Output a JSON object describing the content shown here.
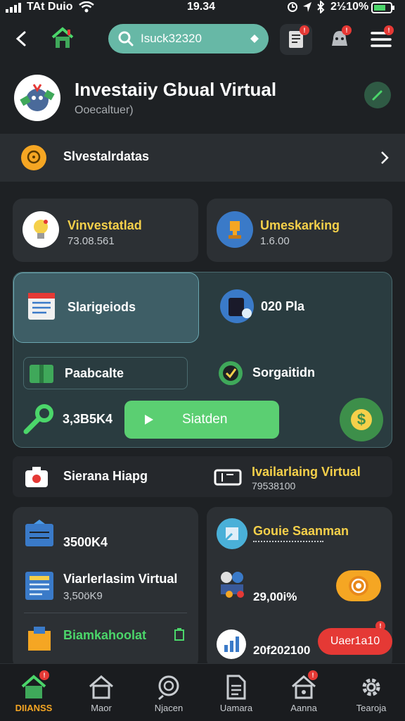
{
  "status": {
    "carrier": "TAt Duio",
    "time": "19.34",
    "battery": "2½10%"
  },
  "search": {
    "value": "Isuck32320"
  },
  "header": {
    "title": "Investaiiy Gbual Virtual",
    "subtitle": "Ooecaltuer)"
  },
  "banner": {
    "label": "Slvestalrdatas"
  },
  "cards": {
    "c1": {
      "title": "Vinvestatlad",
      "value": "73.08.561"
    },
    "c2": {
      "title": "Umeskarking",
      "value": "1.6.00"
    }
  },
  "panel": {
    "item1": "Slarigeiods",
    "item2": "020 Pla",
    "item3": "Paabcalte",
    "item4": "Sorgaitidn",
    "value": "3,3B5K4",
    "button": "Siatden"
  },
  "row": {
    "left": "Sierana Hiapg",
    "right_title": "Ivailarlaing Virtual",
    "right_sub": "79538100"
  },
  "lower_left": {
    "v1": "3500K4",
    "title2": "Viarlerlasim Virtual",
    "v2": "3,50öK9",
    "green": "Biamkahoolat"
  },
  "lower_right": {
    "title1": "Gouie Saanman",
    "v1": "29,00i%",
    "v2": "20f202100",
    "pill": "Uaer1a10"
  },
  "nav": [
    {
      "label": "DIIANSS"
    },
    {
      "label": "Maor"
    },
    {
      "label": "Njacen"
    },
    {
      "label": "Uamara"
    },
    {
      "label": "Aanna"
    },
    {
      "label": "Tearoja"
    }
  ],
  "colors": {
    "background": "#1e2124",
    "card": "#2c3034",
    "accent_green": "#4bd66a",
    "accent_yellow": "#f5d04a",
    "badge_red": "#e53935",
    "teal_search": "#67b8a6"
  }
}
